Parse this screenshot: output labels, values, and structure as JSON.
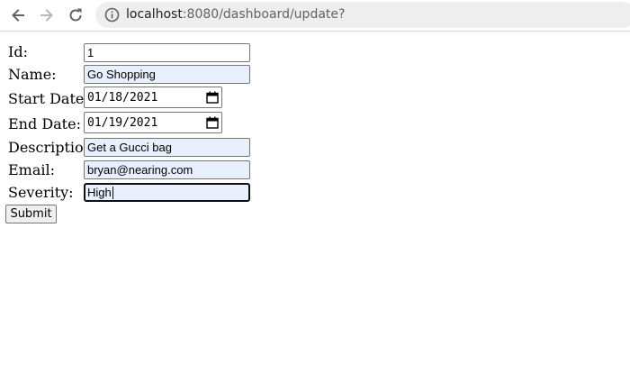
{
  "browser": {
    "url_host": "localhost",
    "url_rest": ":8080/dashboard/update?",
    "icons": [
      "back-arrow-icon",
      "forward-arrow-icon",
      "reload-icon",
      "info-icon"
    ]
  },
  "form": {
    "id_label": "Id:",
    "id_value": "1",
    "name_label": "Name:",
    "name_value": "Go Shopping",
    "start_label": "Start Date:",
    "start_value": "01/18/2021",
    "end_label": "End Date:",
    "end_value": "01/19/2021",
    "description_label": "Description:",
    "description_value": "Get a Gucci bag",
    "email_label": "Email:",
    "email_value": "bryan@nearing.com",
    "severity_label": "Severity:",
    "severity_value": "High",
    "submit_label": "Submit"
  },
  "colors": {
    "autofill_background": "#e8f0fe",
    "omnibox_background": "#eeeeee"
  }
}
